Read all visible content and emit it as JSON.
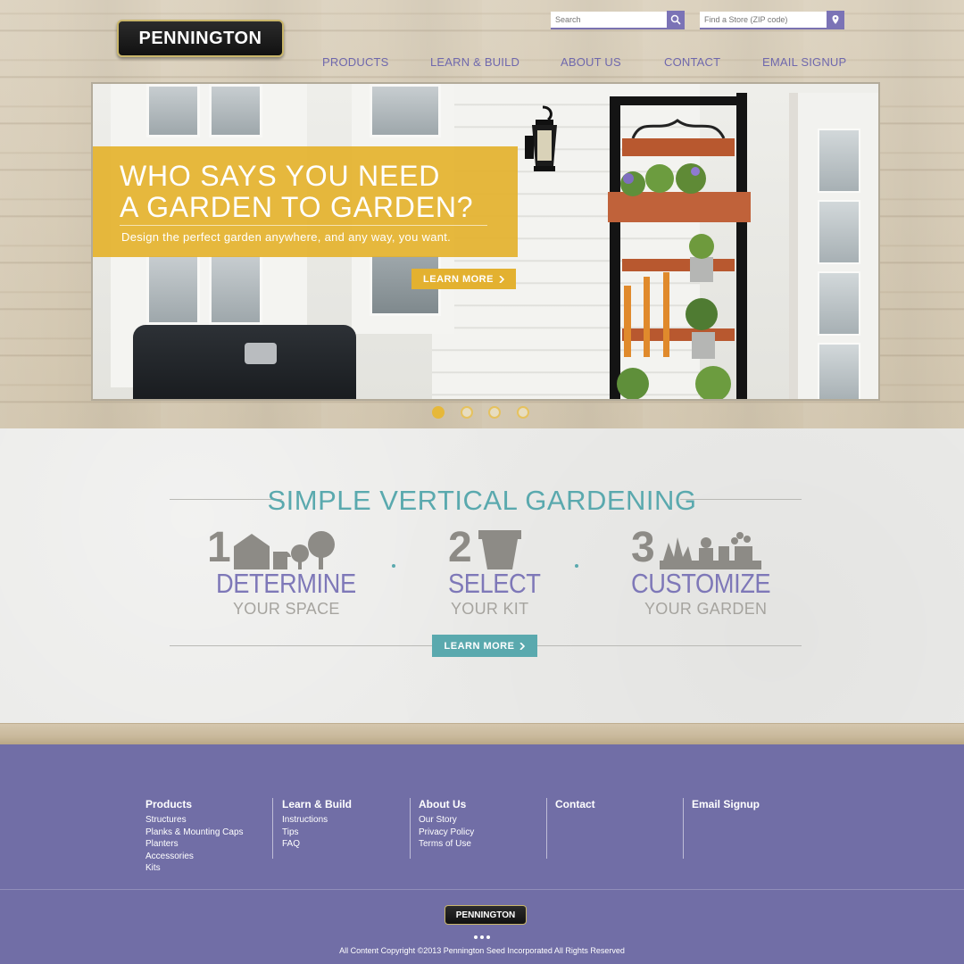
{
  "brand": {
    "logo_text": "PENNINGTON"
  },
  "header": {
    "search": {
      "placeholder": "Search"
    },
    "store_finder": {
      "placeholder": "Find a Store (ZIP code)"
    },
    "nav": [
      "PRODUCTS",
      "LEARN & BUILD",
      "ABOUT US",
      "CONTACT",
      "EMAIL SIGNUP"
    ]
  },
  "hero": {
    "headline_line1": "WHO SAYS YOU NEED",
    "headline_line2": "A GARDEN TO GARDEN?",
    "subline": "Design the perfect garden anywhere, and any way, you want.",
    "button_label": "LEARN MORE",
    "slides_count": 4,
    "active_slide": 1
  },
  "steps_section": {
    "title": "SIMPLE VERTICAL GARDENING",
    "steps": [
      {
        "number": "1",
        "big": "DETERMINE",
        "small": "YOUR SPACE"
      },
      {
        "number": "2",
        "big": "SELECT",
        "small": "YOUR KIT"
      },
      {
        "number": "3",
        "big": "CUSTOMIZE",
        "small": "YOUR GARDEN"
      }
    ],
    "button_label": "LEARN MORE"
  },
  "footer": {
    "columns": [
      {
        "heading": "Products",
        "links": [
          "Structures",
          "Planks & Mounting Caps",
          "Planters",
          "Accessories",
          "Kits"
        ]
      },
      {
        "heading": "Learn & Build",
        "links": [
          "Instructions",
          "Tips",
          "FAQ"
        ]
      },
      {
        "heading": "About Us",
        "links": [
          "Our Story",
          "Privacy Policy",
          "Terms of Use"
        ]
      },
      {
        "heading": "Contact",
        "links": []
      },
      {
        "heading": "Email Signup",
        "links": []
      }
    ],
    "logo_text": "PENNINGTON",
    "copyright": "All Content Copyright ©2013 Pennington Seed Incorporated All Rights Reserved"
  },
  "colors": {
    "accent_purple": "#716ea6",
    "accent_teal": "#5aa9ae",
    "accent_gold": "#e3b130"
  },
  "icons": [
    "search-icon",
    "location-pin-icon",
    "chevron-right-icon",
    "house-tree-icon",
    "pot-icon",
    "plants-icon"
  ]
}
